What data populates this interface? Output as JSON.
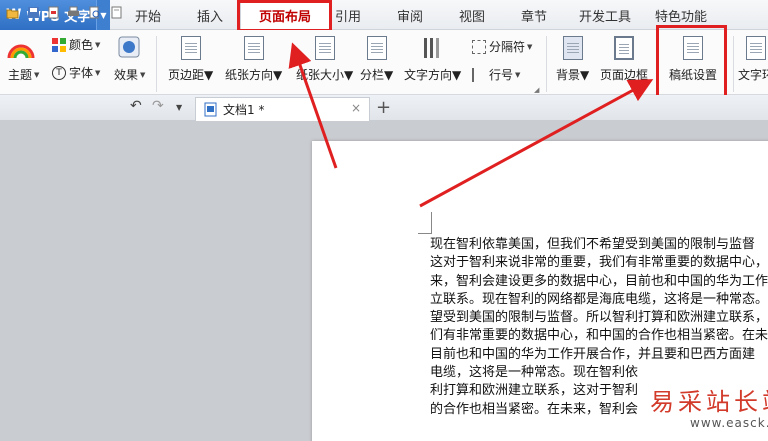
{
  "app": {
    "name": "WPS 文字"
  },
  "menu": {
    "tabs": [
      "开始",
      "插入",
      "页面布局",
      "引用",
      "审阅",
      "视图",
      "章节",
      "开发工具",
      "特色功能"
    ],
    "active_tab": "页面布局"
  },
  "ribbon": {
    "theme_label": "主题",
    "colors_label": "颜色",
    "font_label": "字体",
    "effects_label": "效果",
    "margins_label": "页边距",
    "orientation_label": "纸张方向",
    "size_label": "纸张大小",
    "columns_label": "分栏",
    "text_direction_label": "文字方向",
    "breaks_label": "分隔符",
    "line_numbers_label": "行号",
    "background_label": "背景",
    "page_border_label": "页面边框",
    "manuscript_label": "稿纸设置",
    "text_wrap_label": "文字环"
  },
  "document": {
    "tab_title": "文档1 *",
    "lines": [
      "现在智利依靠美国，但我们不希望受到美国的限制与监督",
      "这对于智利来说非常的重要，我们有非常重要的数据中心，",
      "来，智利会建设更多的数据中心，目前也和中国的华为工作开",
      "立联系。现在智利的网络都是海底电缆，这将是一种常态。",
      "望受到美国的限制与监督。所以智利打算和欧洲建立联系，",
      "们有非常重要的数据中心，和中国的合作也相当紧密。在未",
      "目前也和中国的华为工作开展合作，并且要和巴西方面建",
      "电缆，这将是一种常态。现在智利依",
      "利打算和欧洲建立联系，这对于智利",
      "的合作也相当紧密。在未来，智利会"
    ]
  },
  "watermark": {
    "text": "易采站长站",
    "url": "www.easck.com"
  },
  "colors": {
    "accent": "#2f6fc4",
    "highlight": "#e02020",
    "active_tab_text": "#c00000"
  }
}
